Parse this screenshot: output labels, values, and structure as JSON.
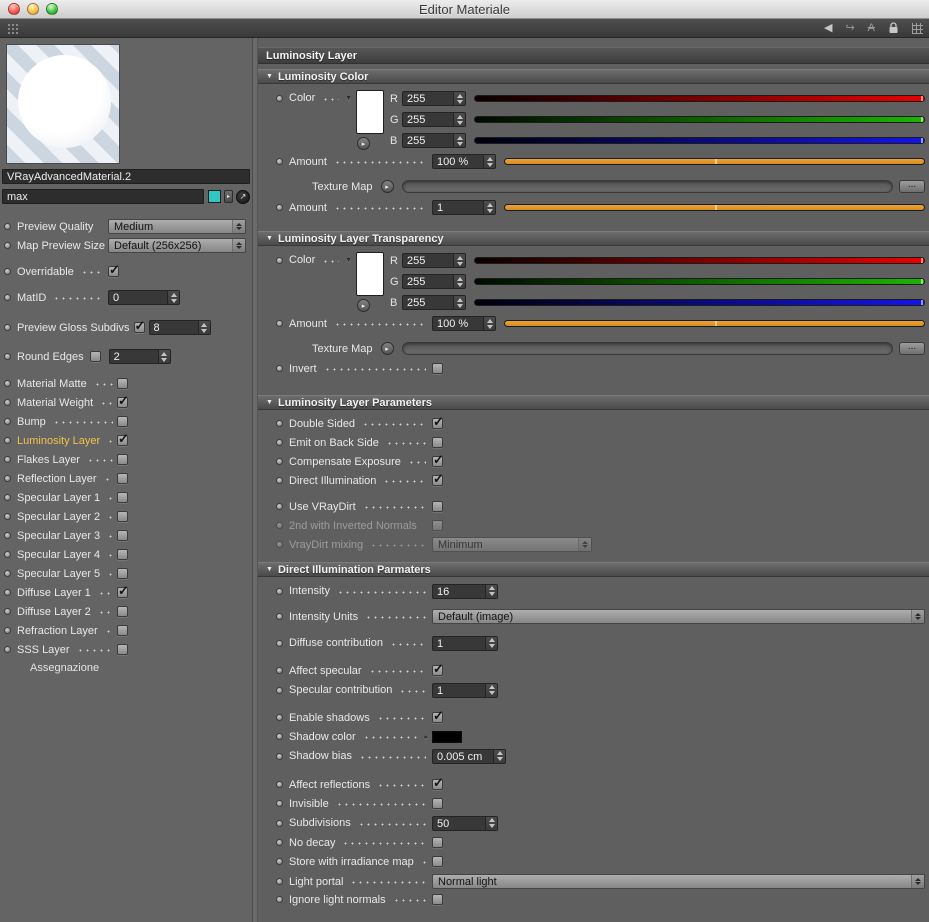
{
  "colors": {
    "accent_orange": "#eda33a",
    "selected_layer": "#f2c14b",
    "teal_swatch": "#2fc7c6",
    "slider_red": "#e80000",
    "slider_green": "#1db400",
    "slider_blue": "#1414e8",
    "shadow_color_swatch": "#000000",
    "luminosity_color_swatch": "#ffffff"
  },
  "window": {
    "title": "Editor Materiale"
  },
  "left_panel": {
    "material_name": "VRayAdvancedMaterial.2",
    "shader_name": "max",
    "preview_quality": {
      "label": "Preview Quality",
      "value": "Medium"
    },
    "map_preview_size": {
      "label": "Map Preview Size",
      "value": "Default (256x256)"
    },
    "overridable": {
      "label": "Overridable",
      "checked": true
    },
    "mat_id": {
      "label": "MatID",
      "value": "0"
    },
    "preview_gloss_subdivs": {
      "label": "Preview Gloss Subdivs",
      "checked": true,
      "value": "8"
    },
    "round_edges": {
      "label": "Round Edges",
      "checked": false,
      "value": "2"
    },
    "layers": [
      {
        "label": "Material Matte",
        "checked": false,
        "selected": false
      },
      {
        "label": "Material Weight",
        "checked": true,
        "selected": false
      },
      {
        "label": "Bump",
        "checked": false,
        "selected": false
      },
      {
        "label": "Luminosity Layer",
        "checked": true,
        "selected": true
      },
      {
        "label": "Flakes Layer",
        "checked": false,
        "selected": false
      },
      {
        "label": "Reflection Layer",
        "checked": false,
        "selected": false
      },
      {
        "label": "Specular Layer 1",
        "checked": false,
        "selected": false
      },
      {
        "label": "Specular Layer 2",
        "checked": false,
        "selected": false
      },
      {
        "label": "Specular Layer 3",
        "checked": false,
        "selected": false
      },
      {
        "label": "Specular Layer 4",
        "checked": false,
        "selected": false
      },
      {
        "label": "Specular Layer 5",
        "checked": false,
        "selected": false
      },
      {
        "label": "Diffuse Layer 1",
        "checked": true,
        "selected": false
      },
      {
        "label": "Diffuse Layer 2",
        "checked": false,
        "selected": false
      },
      {
        "label": "Refraction Layer",
        "checked": false,
        "selected": false
      },
      {
        "label": "SSS Layer",
        "checked": false,
        "selected": false
      }
    ],
    "assignment_label": "Assegnazione"
  },
  "right_panel": {
    "panel_title": "Luminosity Layer",
    "luminosity_color": {
      "section_title": "Luminosity Color",
      "color_label": "Color",
      "channels": [
        {
          "letter": "R",
          "value": "255"
        },
        {
          "letter": "G",
          "value": "255"
        },
        {
          "letter": "B",
          "value": "255"
        }
      ],
      "amount": {
        "label": "Amount",
        "value": "100 %"
      },
      "texture_map": {
        "label": "Texture Map",
        "browse": "..."
      },
      "amount2": {
        "label": "Amount",
        "value": "1"
      }
    },
    "transparency": {
      "section_title": "Luminosity Layer Transparency",
      "color_label": "Color",
      "channels": [
        {
          "letter": "R",
          "value": "255"
        },
        {
          "letter": "G",
          "value": "255"
        },
        {
          "letter": "B",
          "value": "255"
        }
      ],
      "amount": {
        "label": "Amount",
        "value": "100 %"
      },
      "texture_map": {
        "label": "Texture Map",
        "browse": "..."
      },
      "invert": {
        "label": "Invert",
        "checked": false
      }
    },
    "layer_parameters": {
      "section_title": "Luminosity Layer Parameters",
      "double_sided": {
        "label": "Double Sided",
        "checked": true
      },
      "emit_back_side": {
        "label": "Emit on Back Side",
        "checked": false
      },
      "compensate_exposure": {
        "label": "Compensate Exposure",
        "checked": true
      },
      "direct_illumination": {
        "label": "Direct Illumination",
        "checked": true
      },
      "use_vraydirt": {
        "label": "Use VRayDirt",
        "checked": false
      },
      "inverted_normals": {
        "label": "2nd with Inverted Normals",
        "checked": false,
        "disabled": true
      },
      "vraydirt_mixing": {
        "label": "VrayDirt mixing",
        "value": "Minimum",
        "disabled": true
      }
    },
    "direct_illumination": {
      "section_title": "Direct Illumination Parmaters",
      "intensity": {
        "label": "Intensity",
        "value": "16"
      },
      "intensity_units": {
        "label": "Intensity Units",
        "value": "Default (image)"
      },
      "diffuse_contribution": {
        "label": "Diffuse contribution",
        "value": "1"
      },
      "affect_specular": {
        "label": "Affect specular",
        "checked": true
      },
      "specular_contribution": {
        "label": "Specular contribution",
        "value": "1"
      },
      "enable_shadows": {
        "label": "Enable shadows",
        "checked": true
      },
      "shadow_color": {
        "label": "Shadow color"
      },
      "shadow_bias": {
        "label": "Shadow bias",
        "value": "0.005 cm"
      },
      "affect_reflections": {
        "label": "Affect reflections",
        "checked": true
      },
      "invisible": {
        "label": "Invisible",
        "checked": false
      },
      "subdivisions": {
        "label": "Subdivisions",
        "value": "50"
      },
      "no_decay": {
        "label": "No decay",
        "checked": false
      },
      "store_irradiance": {
        "label": "Store with irradiance map",
        "checked": false
      },
      "light_portal": {
        "label": "Light portal",
        "value": "Normal light"
      },
      "ignore_light_normals": {
        "label": "Ignore light normals",
        "checked": false
      }
    }
  }
}
